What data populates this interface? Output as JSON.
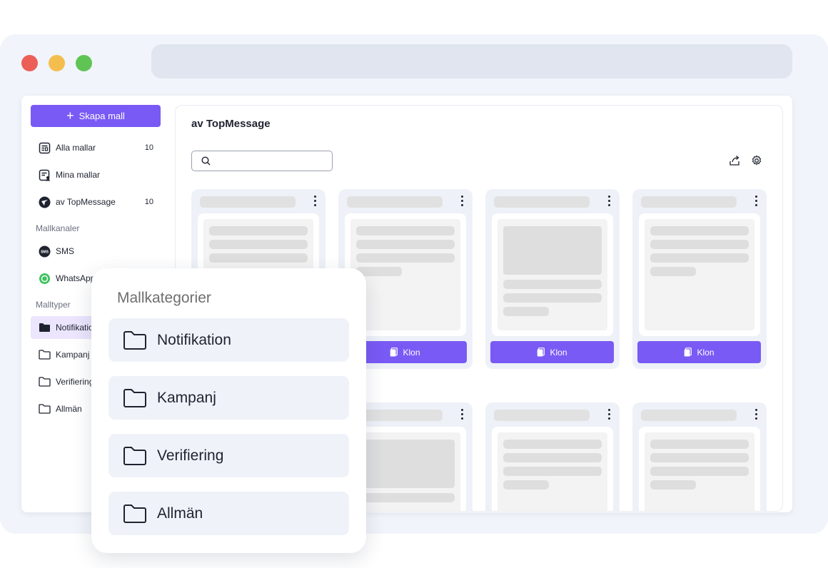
{
  "sidebar": {
    "create_label": "Skapa mall",
    "items": [
      {
        "label": "Alla mallar",
        "count": "10",
        "icon": "templates-icon"
      },
      {
        "label": "Mina mallar",
        "count": "",
        "icon": "my-templates-icon"
      },
      {
        "label": "av TopMessage",
        "count": "10",
        "icon": "topmessage-logo-icon"
      }
    ],
    "channels_label": "Mallkanaler",
    "channels": [
      {
        "label": "SMS",
        "icon": "sms-icon"
      },
      {
        "label": "WhatsApp",
        "icon": "whatsapp-icon"
      }
    ],
    "types_label": "Malltyper",
    "types": [
      {
        "label": "Notifikation",
        "icon": "folder-filled-icon"
      },
      {
        "label": "Kampanj",
        "icon": "folder-icon"
      },
      {
        "label": "Verifiering",
        "icon": "folder-icon"
      },
      {
        "label": "Allmän",
        "icon": "folder-icon"
      }
    ]
  },
  "main": {
    "title": "av TopMessage",
    "search": {
      "placeholder": "",
      "value": ""
    },
    "clone_label": "Klon"
  },
  "popup": {
    "title": "Mallkategorier",
    "categories": [
      "Notifikation",
      "Kampanj",
      "Verifiering",
      "Allmän"
    ]
  },
  "colors": {
    "accent": "#7a5af5",
    "active_bg": "#ebe5fd",
    "card_bg": "#eef1f8"
  }
}
